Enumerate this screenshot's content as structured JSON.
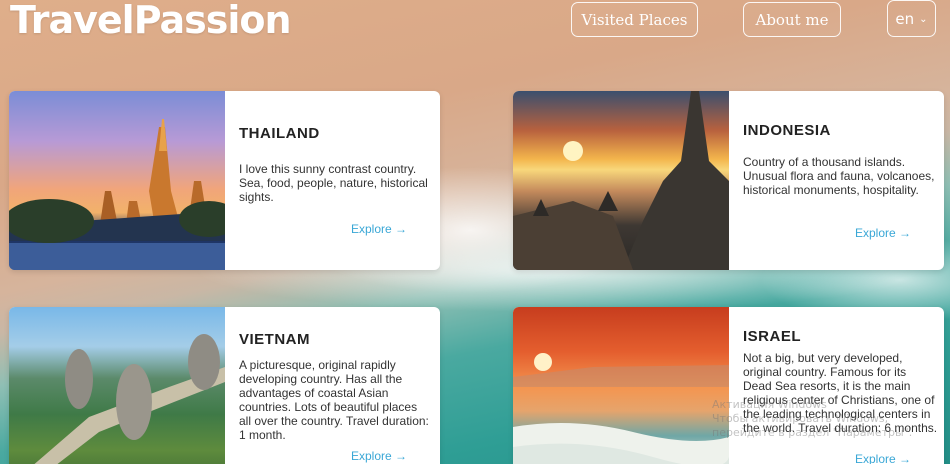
{
  "header": {
    "logo": "TravelPassion",
    "nav": {
      "visited_label": "Visited Places",
      "about_label": "About me"
    },
    "language": {
      "selected": "en"
    }
  },
  "cards": [
    {
      "title": "THAILAND",
      "description": "I love this sunny contrast country. Sea, food, people, nature, historical sights.",
      "explore": "Explore →"
    },
    {
      "title": "INDONESIA",
      "description": "Country of a thousand islands. Unusual flora and fauna, volcanoes, historical monuments, hospitality.",
      "explore": "Explore →"
    },
    {
      "title": "VIETNAM",
      "description": "A picturesque, original rapidly developing country. Has all the advantages of coastal Asian countries. Lots of beautiful places all over the country. Travel duration: 1 month.",
      "explore": "Explore →"
    },
    {
      "title": "ISRAEL",
      "description": "Not a big, but very developed, original country. Famous for its Dead Sea resorts, it is the main religious center of Christians, one of the leading technological centers in the world. Travel duration: 6 months.",
      "explore": "Explore →"
    }
  ],
  "os_overlay": {
    "line1": "Активация Windows",
    "line2": "Чтобы активировать Windows, перейдите в раздел \"Параметры\"."
  }
}
